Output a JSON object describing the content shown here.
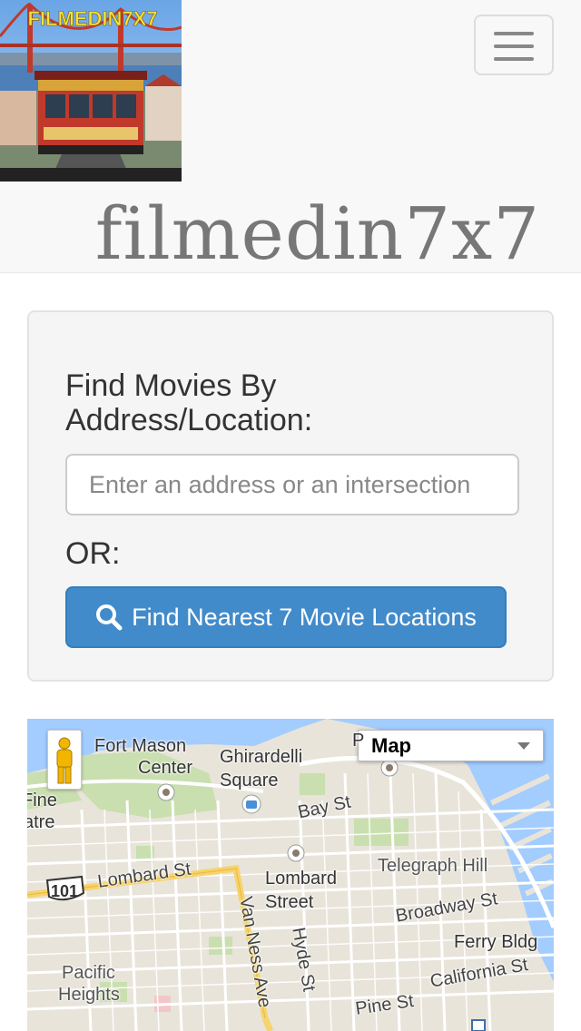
{
  "header": {
    "logo_text": "FILMEDIN7X7",
    "brand": "filmedin7x7",
    "menu_toggle": "Toggle navigation"
  },
  "search": {
    "heading": "Find Movies By Address/Location:",
    "placeholder": "Enter an address or an intersection",
    "or_label": "OR:",
    "nearest_button": "Find Nearest 7 Movie Locations"
  },
  "map": {
    "map_type": "Map",
    "labels": {
      "fort_mason": "Fort Mason",
      "center": "Center",
      "ghirardelli": "Ghirardelli",
      "square": "Square",
      "fine": "Fine",
      "atre": "atre",
      "bay_st": "Bay St",
      "lombard_st": "Lombard St",
      "hwy_101": "101",
      "lombard": "Lombard",
      "street": "Street",
      "telegraph_hill": "Telegraph Hill",
      "broadway_st": "Broadway St",
      "van_ness_ave": "Van Ness Ave",
      "hyde_st": "Hyde St",
      "ferry_bldg": "Ferry Bldg",
      "pacific": "Pacific",
      "heights": "Heights",
      "california_st": "California St",
      "pine_st": "Pine St",
      "partial_p": "P"
    },
    "colors": {
      "land": "#e8e4da",
      "water": "#a3ccff",
      "park": "#c9dfaf",
      "road": "#ffffff",
      "highway": "#f7d36b"
    }
  },
  "colors": {
    "primary": "#428bca",
    "navbar_bg": "#f8f8f8",
    "well_bg": "#f5f5f5"
  }
}
